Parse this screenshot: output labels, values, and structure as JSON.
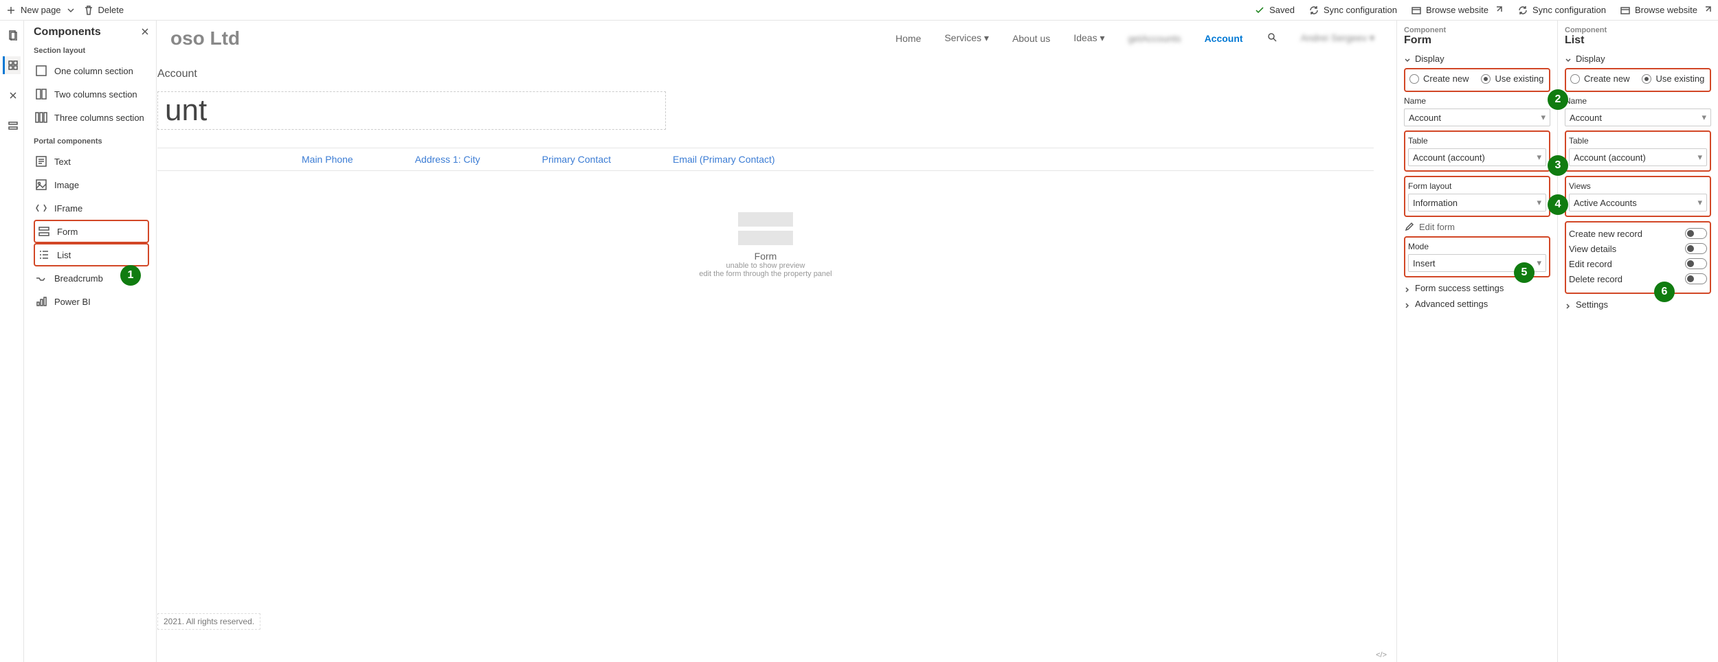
{
  "toolbar": {
    "new_page": "New page",
    "delete": "Delete",
    "saved": "Saved",
    "sync_config": "Sync configuration",
    "browse_website": "Browse website"
  },
  "components_panel": {
    "title": "Components",
    "section_layout_title": "Section layout",
    "section_layouts": [
      "One column section",
      "Two columns section",
      "Three columns section"
    ],
    "portal_title": "Portal components",
    "portal_items": [
      "Text",
      "Image",
      "IFrame",
      "Form",
      "List",
      "Breadcrumb",
      "Power BI"
    ]
  },
  "canvas": {
    "brand": "oso Ltd",
    "nav": {
      "home": "Home",
      "services": "Services",
      "about": "About us",
      "ideas": "Ideas",
      "get_accounts": "getAccounts",
      "account": "Account",
      "user": "Andrei Sergeev"
    },
    "breadcrumb": "Account",
    "page_heading": "unt",
    "grid_headers": [
      "Main Phone",
      "Address 1: City",
      "Primary Contact",
      "Email (Primary Contact)"
    ],
    "form_placeholder": {
      "title": "Form",
      "line2": "unable to show preview",
      "line3": "edit the form through the property panel"
    },
    "footer": "2021. All rights reserved.",
    "code_glyph": "</>"
  },
  "form_panel": {
    "component_label": "Component",
    "component_name": "Form",
    "display_section": "Display",
    "create_new": "Create new",
    "use_existing": "Use existing",
    "name_label": "Name",
    "name_value": "Account",
    "table_label": "Table",
    "table_value": "Account (account)",
    "form_layout_label": "Form layout",
    "form_layout_value": "Information",
    "edit_form": "Edit form",
    "mode_label": "Mode",
    "mode_value": "Insert",
    "success_section": "Form success settings",
    "advanced_section": "Advanced settings"
  },
  "list_panel": {
    "component_label": "Component",
    "component_name": "List",
    "display_section": "Display",
    "create_new": "Create new",
    "use_existing": "Use existing",
    "name_label": "Name",
    "name_value": "Account",
    "table_label": "Table",
    "table_value": "Account (account)",
    "views_label": "Views",
    "views_value": "Active Accounts",
    "create_new_record": "Create new record",
    "view_details": "View details",
    "edit_record": "Edit record",
    "delete_record": "Delete record",
    "settings_section": "Settings"
  },
  "badges": {
    "1": "1",
    "2": "2",
    "3": "3",
    "4": "4",
    "5": "5",
    "6": "6"
  }
}
